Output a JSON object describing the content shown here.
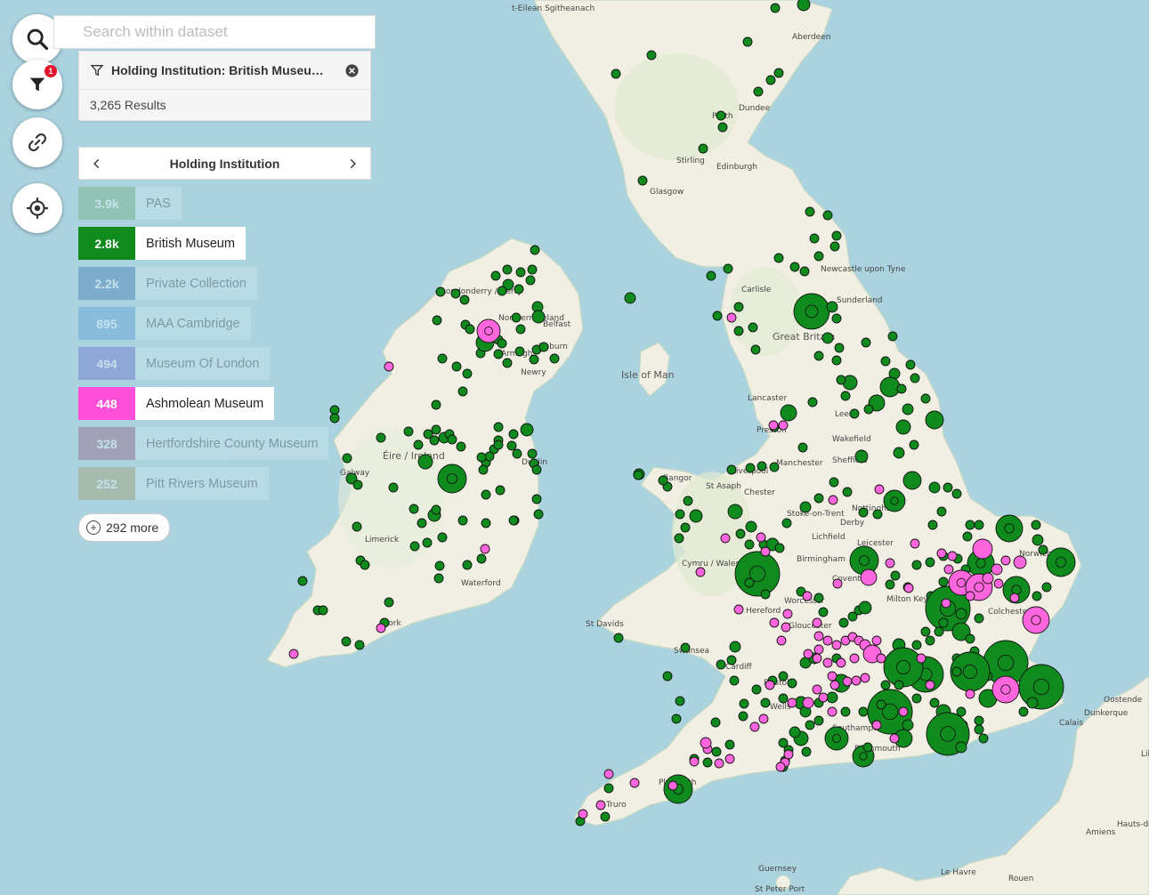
{
  "search": {
    "placeholder": "Search within dataset"
  },
  "active_filter": {
    "label": "Holding Institution: British Museu…",
    "count_badge": "1"
  },
  "results_text": "3,265 Results",
  "facet_nav": {
    "title": "Holding Institution"
  },
  "facets": [
    {
      "count": "3.9k",
      "label": "PAS",
      "color": "#5aa35a",
      "active": false
    },
    {
      "count": "2.8k",
      "label": "British Museum",
      "color": "#0f8a1c",
      "active": true
    },
    {
      "count": "2.2k",
      "label": "Private Collection",
      "color": "#1f5fae",
      "active": false
    },
    {
      "count": "895",
      "label": "MAA Cambridge",
      "color": "#3f8fd8",
      "active": false
    },
    {
      "count": "494",
      "label": "Museum Of London",
      "color": "#5548c8",
      "active": false
    },
    {
      "count": "448",
      "label": "Ashmolean Museum",
      "color": "#ff4fd8",
      "active": true
    },
    {
      "count": "328",
      "label": "Hertfordshire County Museum",
      "color": "#8c3a6a",
      "active": false
    },
    {
      "count": "252",
      "label": "Pitt Rivers Museum",
      "color": "#9a8a4a",
      "active": false
    }
  ],
  "more_label": "292 more",
  "icons": {
    "search": "search-icon",
    "filter": "filter-icon",
    "link": "link-icon",
    "locate": "locate-icon",
    "clear": "clear-icon"
  },
  "colors": {
    "water": "#aad3df",
    "land": "#f2efe6",
    "british_museum_marker": "#0f8a1c",
    "ashmolean_marker": "#ff66dd"
  },
  "map_labels": [
    "t-Eilean Sgitheanach",
    "Aberdeen",
    "Dundee",
    "Perth",
    "Stirling",
    "Edinburgh",
    "Glasgow",
    "Newcastle upon Tyne",
    "Carlisle",
    "Sunderland",
    "Great Britain",
    "Londonderry / Derry",
    "Northern Ireland",
    "Belfast",
    "Lisburn",
    "Armagh",
    "Newry",
    "Isle of Man",
    "Lancaster",
    "Leeds",
    "Preston",
    "Wakefield",
    "Manchester",
    "Sheffield",
    "Liverpool",
    "St Asaph",
    "Bangor",
    "Chester",
    "Stoke-on-Trent",
    "Nottingham",
    "Derby",
    "Lichfield",
    "Leicester",
    "Birmingham",
    "Coventry",
    "Cymru / Wales",
    "Éire / Ireland",
    "Dublin",
    "Galway",
    "Limerick",
    "Waterford",
    "Cork",
    "St Davids",
    "Hereford",
    "Worcester",
    "Gloucester",
    "Milton Keynes",
    "Colchester",
    "Norwich",
    "Swansea",
    "Cardiff",
    "Bristol",
    "Wells",
    "Southampton",
    "Portsmouth",
    "Plymouth",
    "Truro",
    "Oostende",
    "Dunkerque",
    "Calais",
    "Hauts-de-France",
    "Amiens",
    "Le Havre",
    "Rouen",
    "Guernsey",
    "St Peter Port",
    "Lille"
  ]
}
